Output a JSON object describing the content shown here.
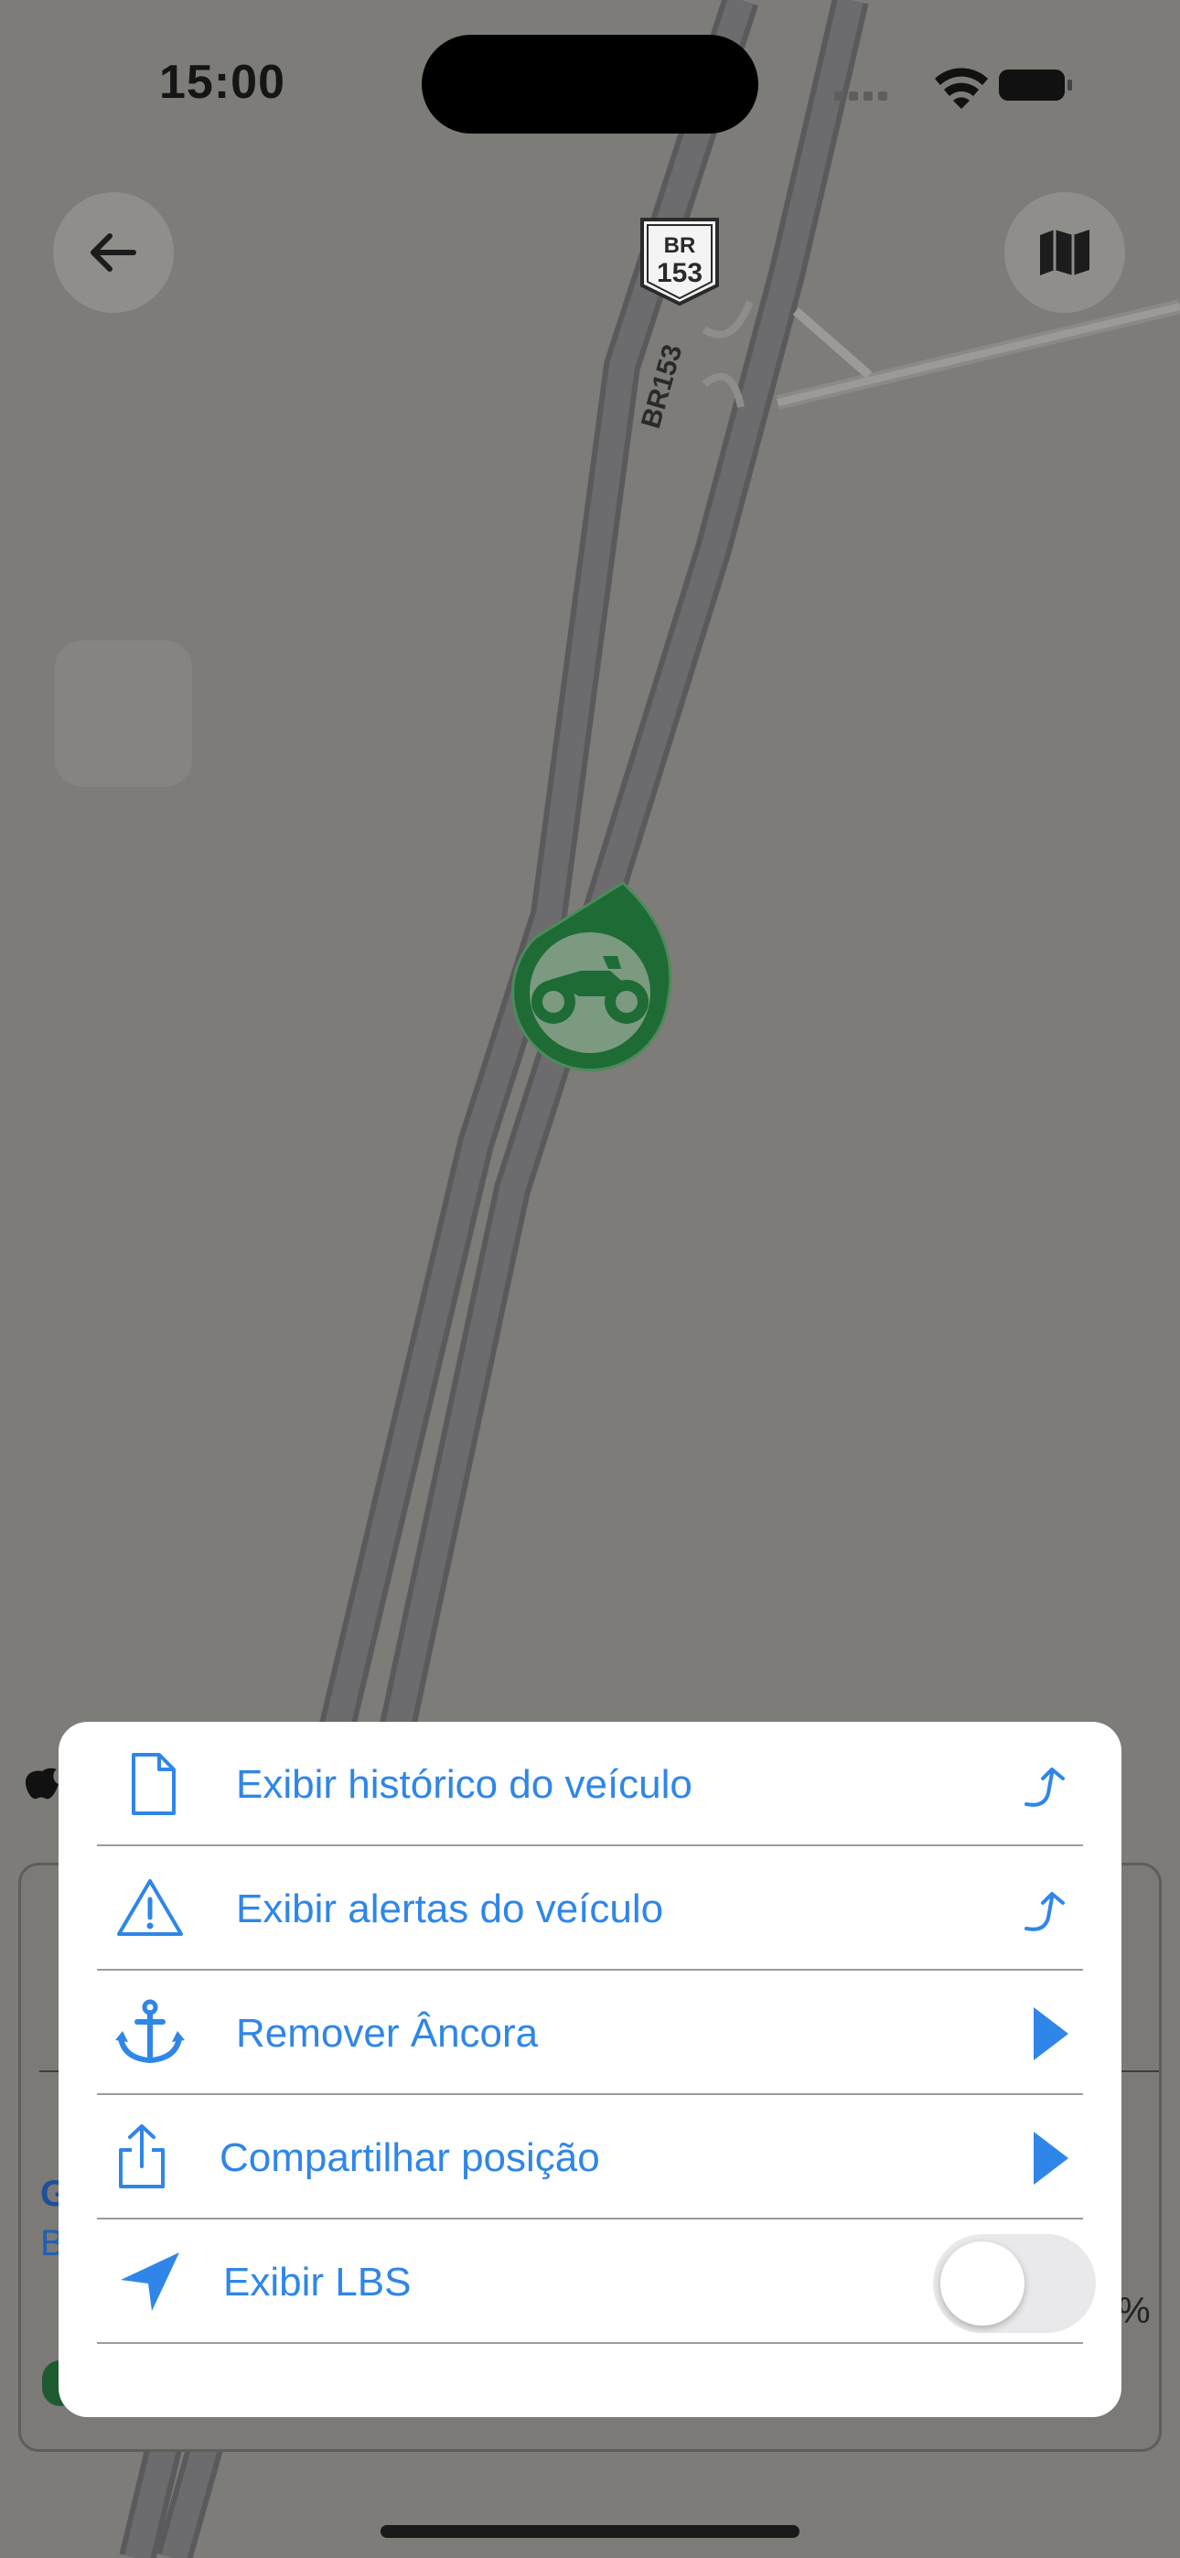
{
  "status_bar": {
    "time": "15:00"
  },
  "map": {
    "shield_top": "BR",
    "shield_number": "153",
    "road_label": "BR153",
    "marker_color": "#1e6b35"
  },
  "nav": {
    "back_icon": "arrow-left-icon",
    "map_mode_icon": "map-icon"
  },
  "action_sheet": {
    "items": [
      {
        "label": "Exibir histórico do veículo",
        "icon": "document-icon",
        "trailing": "external-arrow-icon"
      },
      {
        "label": "Exibir alertas do veículo",
        "icon": "warning-icon",
        "trailing": "external-arrow-icon"
      },
      {
        "label": "Remover Âncora",
        "icon": "anchor-icon",
        "trailing": "play-icon"
      },
      {
        "label": "Compartilhar posição",
        "icon": "share-icon",
        "trailing": "play-icon"
      },
      {
        "label": "Exibir LBS",
        "icon": "location-arrow-icon",
        "trailing": "toggle-switch",
        "toggle_on": false
      }
    ],
    "accent_color": "#2f86e8"
  },
  "background_card": {
    "peek_chars": [
      "G",
      "B",
      "%"
    ]
  }
}
